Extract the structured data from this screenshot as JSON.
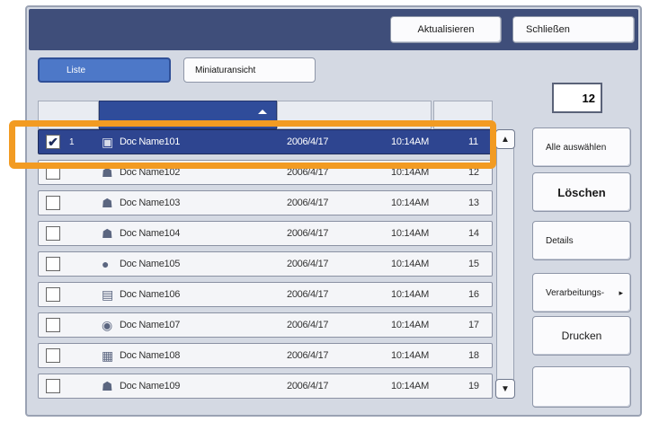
{
  "toolbar": {
    "refresh_label": "Aktualisieren",
    "close_label": "Schließen"
  },
  "tabs": {
    "list_label": "Liste",
    "thumbnail_label": "Miniaturansicht"
  },
  "doc_count": "12",
  "rows": [
    {
      "index": "1",
      "name": "Doc Name101",
      "date": "2006/4/17",
      "time": "10:14AM",
      "num": "11",
      "selected": true
    },
    {
      "index": "",
      "name": "Doc Name102",
      "date": "2006/4/17",
      "time": "10:14AM",
      "num": "12",
      "selected": false
    },
    {
      "index": "",
      "name": "Doc Name103",
      "date": "2006/4/17",
      "time": "10:14AM",
      "num": "13",
      "selected": false
    },
    {
      "index": "",
      "name": "Doc Name104",
      "date": "2006/4/17",
      "time": "10:14AM",
      "num": "14",
      "selected": false
    },
    {
      "index": "",
      "name": "Doc Name105",
      "date": "2006/4/17",
      "time": "10:14AM",
      "num": "15",
      "selected": false
    },
    {
      "index": "",
      "name": "Doc Name106",
      "date": "2006/4/17",
      "time": "10:14AM",
      "num": "16",
      "selected": false
    },
    {
      "index": "",
      "name": "Doc Name107",
      "date": "2006/4/17",
      "time": "10:14AM",
      "num": "17",
      "selected": false
    },
    {
      "index": "",
      "name": "Doc Name108",
      "date": "2006/4/17",
      "time": "10:14AM",
      "num": "18",
      "selected": false
    },
    {
      "index": "",
      "name": "Doc Name109",
      "date": "2006/4/17",
      "time": "10:14AM",
      "num": "19",
      "selected": false
    }
  ],
  "side_buttons": {
    "select_all": "Alle auswählen",
    "delete": "Löschen",
    "details": "Details",
    "processing": "Verarbeitungs-",
    "print": "Drucken"
  },
  "colors": {
    "title_bar": "#3f4e7a",
    "selected_row": "#2e4590",
    "highlight": "#f29b22"
  }
}
